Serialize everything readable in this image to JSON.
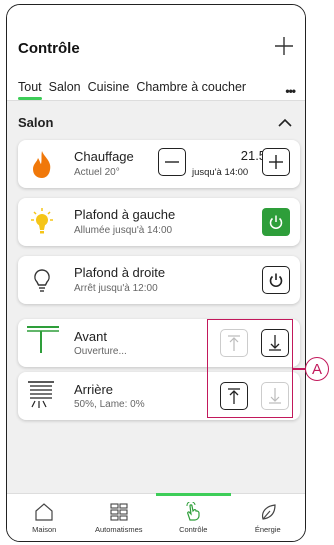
{
  "header": {
    "title": "Contrôle"
  },
  "tabs": [
    "Tout",
    "Salon",
    "Cuisine",
    "Chambre à coucher"
  ],
  "section": {
    "title": "Salon"
  },
  "devices": [
    {
      "name": "Chauffage",
      "status": "Actuel 20°",
      "setpoint": "21.5°",
      "until": "jusqu'à 14:00"
    },
    {
      "name": "Plafond à gauche",
      "status": "Allumée jusqu'à 14:00",
      "state": "on"
    },
    {
      "name": "Plafond à droite",
      "status": "Arrêt jusqu'à 12:00",
      "state": "off"
    },
    {
      "name": "Avant",
      "status": "Ouverture..."
    },
    {
      "name": "Arrière",
      "status": "50%, Lame: 0%"
    }
  ],
  "annotation": "A",
  "bottom_nav": [
    {
      "label": "Maison",
      "icon": "home-icon"
    },
    {
      "label": "Automatismes",
      "icon": "grid-icon"
    },
    {
      "label": "Contrôle",
      "icon": "hand-icon",
      "active": true
    },
    {
      "label": "Énergie",
      "icon": "leaf-icon"
    }
  ],
  "colors": {
    "accent": "#3dcd58",
    "switch_on": "#2e9e3a",
    "flame": "#f0780a",
    "bulb": "#f5c518",
    "annotation": "#c2185b"
  }
}
